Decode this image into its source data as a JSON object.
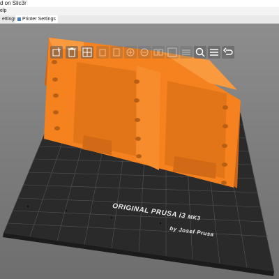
{
  "window": {
    "title_fragment": "d on Slic3r"
  },
  "menu": {
    "fragment": "elp"
  },
  "tabs": [
    {
      "label": "ettings",
      "active": false
    },
    {
      "label": "Printer Settings",
      "active": true
    }
  ],
  "toolbar": {
    "tools": [
      {
        "icon": "add-object-icon",
        "enabled": true
      },
      {
        "icon": "delete-icon",
        "enabled": true
      },
      {
        "icon": "arrange-icon",
        "enabled": true
      },
      {
        "icon": "copy-icon",
        "enabled": false
      },
      {
        "icon": "paste-icon",
        "enabled": false
      },
      {
        "icon": "add-instance-icon",
        "enabled": false
      },
      {
        "icon": "remove-instance-icon",
        "enabled": false
      },
      {
        "icon": "split-objects-icon",
        "enabled": false
      },
      {
        "icon": "split-parts-icon",
        "enabled": false
      },
      {
        "icon": "layers-editing-icon",
        "enabled": false
      },
      {
        "icon": "search-icon",
        "enabled": true
      },
      {
        "icon": "hamburger-menu-icon",
        "enabled": true
      },
      {
        "icon": "undo-icon",
        "enabled": true
      },
      {
        "icon": "redo-icon",
        "enabled": false
      }
    ]
  },
  "bed": {
    "label_line1": "ORIGINAL PRUSA i3",
    "label_model": "MK3",
    "label_line2": "by Josef Prusa"
  },
  "colors": {
    "model": "#f5821f",
    "model_shadow": "#c9651a",
    "bed_surface": "#2a2a2a",
    "grid": "#555555",
    "viewport_background": "#7d7d7d"
  }
}
